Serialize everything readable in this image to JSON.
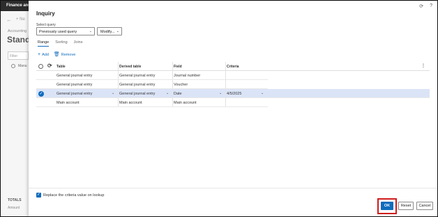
{
  "background": {
    "app_title": "Finance and",
    "nav_back": "←",
    "nav_item": "+ Ne",
    "breadcrumb": "Accounting",
    "page_title": "Standa",
    "filter_placeholder": "Filter",
    "list_item": "Manu",
    "totals_label": "TOTALS",
    "amount_label": "Amount"
  },
  "dialog": {
    "title": "Inquiry",
    "select_query_label": "Select query",
    "select_query_value": "Previously used query",
    "modify_label": "Modify...",
    "tabs": [
      {
        "label": "Range",
        "active": true
      },
      {
        "label": "Sorting",
        "active": false
      },
      {
        "label": "Joins",
        "active": false
      }
    ],
    "actions": {
      "add_label": "Add",
      "remove_label": "Remove"
    },
    "grid": {
      "headers": [
        "Table",
        "Derived table",
        "Field",
        "Criteria"
      ],
      "rows": [
        {
          "table": "General journal entry",
          "derived": "General journal entry",
          "field": "Journal number",
          "criteria": "",
          "selected": false
        },
        {
          "table": "General journal entry",
          "derived": "General journal entry",
          "field": "Voucher",
          "criteria": "",
          "selected": false
        },
        {
          "table": "General journal entry",
          "derived": "General journal entry",
          "field": "Date",
          "criteria": "4/5/2025",
          "selected": true
        },
        {
          "table": "Main account",
          "derived": "Main account",
          "field": "Main account",
          "criteria": "",
          "selected": false
        }
      ]
    },
    "replace_checkbox_label": "Replace the criteria value on lookup",
    "replace_checked": true,
    "buttons": {
      "ok": "OK",
      "reset": "Reset",
      "cancel": "Cancel"
    },
    "accent_color": "#0f6cbd",
    "highlight_color": "#d01c1c"
  }
}
